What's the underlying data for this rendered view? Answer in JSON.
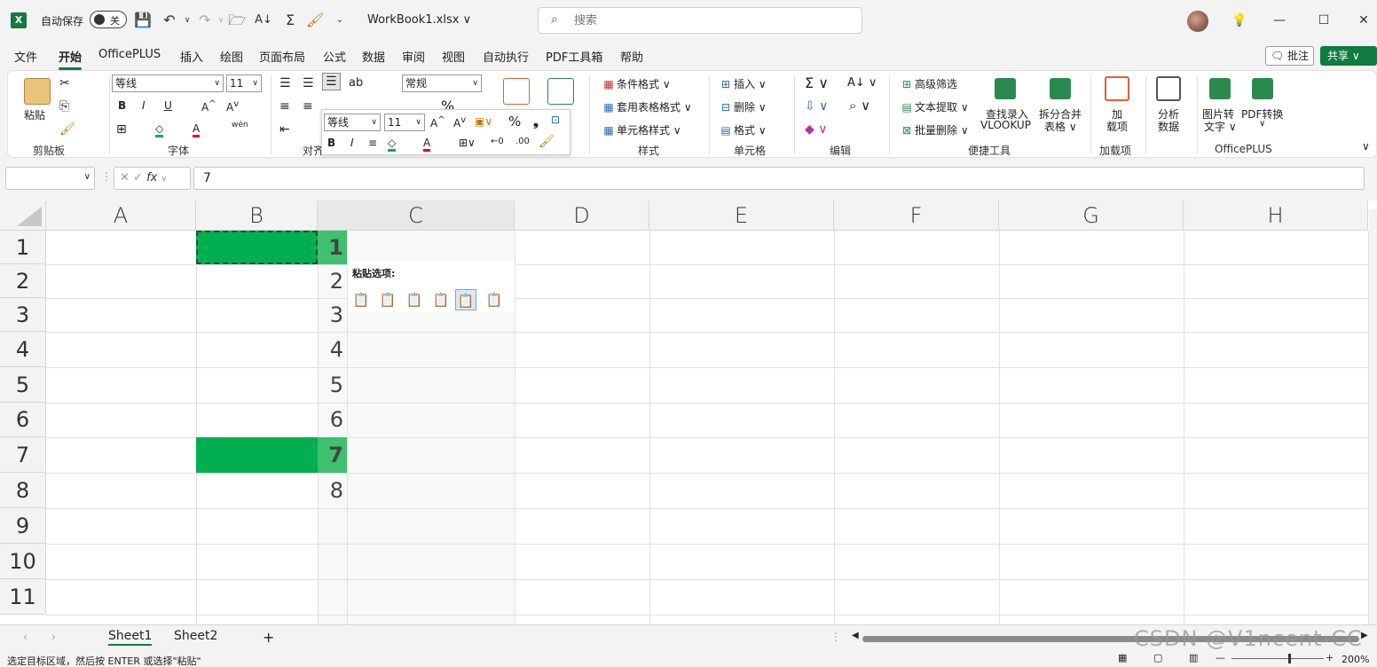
{
  "titlebar": {
    "autosave_label": "自动保存",
    "autosave_state": "关",
    "doc_title": "WorkBook1.xlsx ∨",
    "search_placeholder": "搜索"
  },
  "tabs": [
    "文件",
    "开始",
    "OfficePLUS",
    "插入",
    "绘图",
    "页面布局",
    "公式",
    "数据",
    "审阅",
    "视图",
    "自动执行",
    "PDF工具箱",
    "帮助"
  ],
  "active_tab": "开始",
  "comment_label": "批注",
  "share_label": "共享 ∨",
  "ribbon": {
    "clipboard": {
      "paste": "粘贴",
      "label": "剪贴板"
    },
    "font": {
      "name": "等线",
      "size": "11",
      "label": "字体",
      "bold": "B",
      "italic": "I",
      "underline": "U"
    },
    "align": {
      "label": "对齐"
    },
    "number": {
      "format": "常规",
      "percent": "%"
    },
    "styles": {
      "cond": "条件格式 ∨",
      "table": "套用表格格式 ∨",
      "cell": "单元格样式 ∨",
      "label": "样式"
    },
    "cells": {
      "insert": "插入",
      "delete": "删除",
      "format": "格式 ∨",
      "label": "单元格"
    },
    "editing": {
      "label": "编辑"
    },
    "tools": {
      "adv_filter": "高级筛选",
      "text_extract": "文本提取 ∨",
      "batch_delete": "批量删除 ∨",
      "vlookup_1": "查找录入",
      "vlookup_2": "VLOOKUP",
      "split_1": "拆分合并",
      "split_2": "表格 ∨",
      "label": "便捷工具"
    },
    "addins": {
      "line1": "加",
      "line2": "载项",
      "label": "加载项"
    },
    "analyze": {
      "line1": "分析",
      "line2": "数据"
    },
    "officeplus": {
      "img_1": "图片转",
      "img_2": "文字 ∨",
      "pdf_1": "PDF转换",
      "label": "OfficePLUS"
    }
  },
  "minibar": {
    "font": "等线",
    "size": "11"
  },
  "formula": {
    "fx": "fx",
    "value": "7"
  },
  "columns": [
    "A",
    "B",
    "C",
    "D",
    "E",
    "F",
    "G",
    "H"
  ],
  "rows": [
    "1",
    "2",
    "3",
    "4",
    "5",
    "6",
    "7",
    "8",
    "9",
    "10",
    "11"
  ],
  "column_c_values": [
    "1",
    "2",
    "3",
    "4",
    "5",
    "6",
    "7",
    "8"
  ],
  "paste_options": {
    "title": "粘贴选项:"
  },
  "sheets": [
    "Sheet1",
    "Sheet2"
  ],
  "status_text": "选定目标区域，然后按 ENTER 或选择\"粘贴\"",
  "zoom": "200%",
  "watermark": "CSDN @V1ncent-CC",
  "colors": {
    "accent": "#107c41",
    "cell_fill": "#00b050"
  }
}
